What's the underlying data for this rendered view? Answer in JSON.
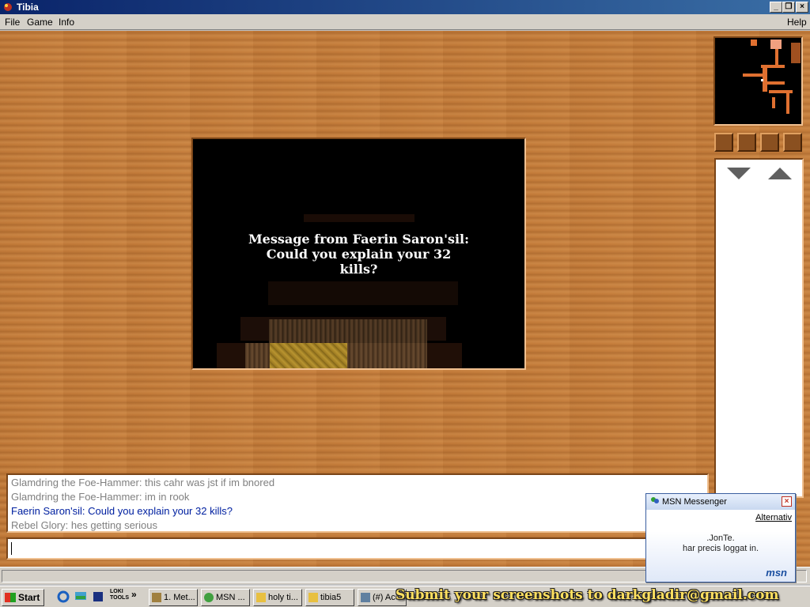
{
  "window": {
    "title": "Tibia"
  },
  "menu": {
    "file": "File",
    "game": "Game",
    "info": "Info",
    "help": "Help"
  },
  "game_message": {
    "line1": "Message from Faerin Saron'sil:",
    "line2": "Could you explain your 32",
    "line3": "kills?"
  },
  "console": {
    "lines": [
      {
        "text": "Glamdring the Foe-Hammer: this cahr was jst if im bnored",
        "color": "#808080"
      },
      {
        "text": "Glamdring the Foe-Hammer: im in rook",
        "color": "#808080"
      },
      {
        "text": "Faerin Saron'sil: Could you explain your 32 kills?",
        "color": "#0020a0"
      },
      {
        "text": "Rebel Glory: hes getting serious",
        "color": "#808080"
      }
    ]
  },
  "taskbar": {
    "start": "Start",
    "loki": "LOKI TOOLS",
    "chevron": "»",
    "buttons": [
      "1. Met...",
      "MSN ...",
      "holy ti...",
      "tibia5",
      "(#) Ac"
    ]
  },
  "msn": {
    "title": "MSN Messenger",
    "link": "Alternativ",
    "contact": ".JonTe.",
    "message": "har precis loggat in.",
    "logo": "msn"
  },
  "watermark": "Submit your screenshots to darkgladir@gmail.com"
}
